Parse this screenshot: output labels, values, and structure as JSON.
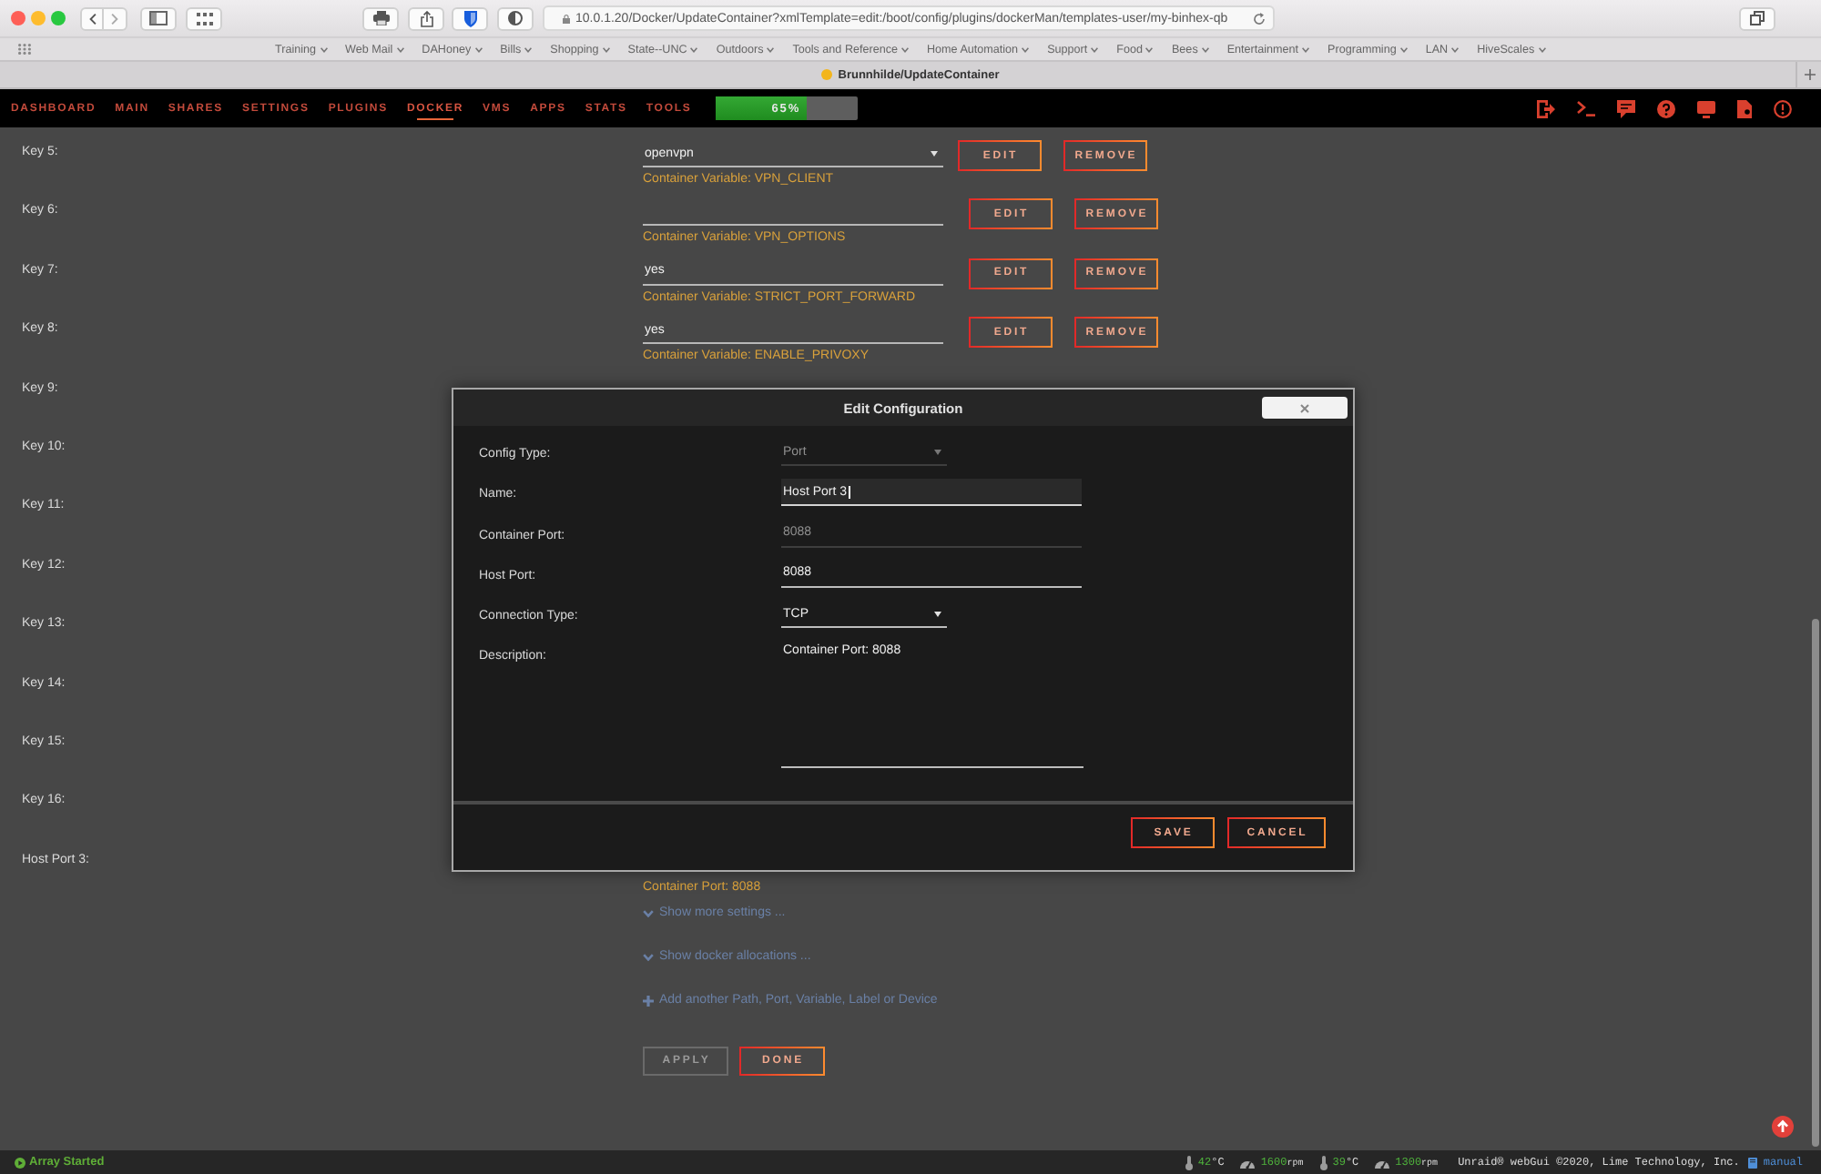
{
  "browser": {
    "url": "10.0.1.20/Docker/UpdateContainer?xmlTemplate=edit:/boot/config/plugins/dockerMan/templates-user/my-binhex-qb",
    "bookmarks": [
      "Training",
      "Web Mail",
      "DAHoney",
      "Bills",
      "Shopping",
      "State--UNC",
      "Outdoors",
      "Tools and Reference",
      "Home Automation",
      "Support",
      "Food",
      "Bees",
      "Entertainment",
      "Programming",
      "LAN",
      "HiveScales"
    ],
    "tab_title": "Brunnhilde/UpdateContainer"
  },
  "nav": {
    "items": [
      {
        "label": "DASHBOARD",
        "selected": false
      },
      {
        "label": "MAIN",
        "selected": false
      },
      {
        "label": "SHARES",
        "selected": false
      },
      {
        "label": "SETTINGS",
        "selected": false
      },
      {
        "label": "PLUGINS",
        "selected": false
      },
      {
        "label": "DOCKER",
        "selected": true
      },
      {
        "label": "VMS",
        "selected": false
      },
      {
        "label": "APPS",
        "selected": false
      },
      {
        "label": "STATS",
        "selected": false
      },
      {
        "label": "TOOLS",
        "selected": false
      }
    ],
    "progress": {
      "label": "65%",
      "level": 0.65
    }
  },
  "template_rows": [
    {
      "label": "Key 5:",
      "kind": "select",
      "value": "openvpn",
      "description": "Container Variable: VPN_CLIENT",
      "buttons": [
        "EDIT",
        "REMOVE"
      ]
    },
    {
      "label": "Key 6:",
      "kind": "text",
      "description": "Container Variable: VPN_OPTIONS",
      "buttons": [
        "EDIT",
        "REMOVE"
      ]
    },
    {
      "label": "Key 7:",
      "kind": "text",
      "value": "yes",
      "description": "Container Variable: STRICT_PORT_FORWARD",
      "buttons": [
        "EDIT",
        "REMOVE"
      ]
    },
    {
      "label": "Key 8:",
      "kind": "text",
      "value": "yes",
      "description": "Container Variable: ENABLE_PRIVOXY",
      "buttons": [
        "EDIT",
        "REMOVE"
      ]
    },
    {
      "label": "Key 9:",
      "kind": "covered"
    },
    {
      "label": "Key 10:",
      "kind": "covered"
    },
    {
      "label": "Key 11:",
      "kind": "covered"
    },
    {
      "label": "Key 12:",
      "kind": "covered"
    },
    {
      "label": "Key 13:",
      "kind": "covered"
    },
    {
      "label": "Key 14:",
      "kind": "covered"
    },
    {
      "label": "Key 15:",
      "kind": "covered"
    },
    {
      "label": "Key 16:",
      "kind": "covered"
    },
    {
      "label": "Host Port 3:",
      "kind": "covered",
      "description": "Container Port: 8088"
    }
  ],
  "links": [
    {
      "kind": "expand",
      "label": "Show more settings ..."
    },
    {
      "kind": "expand",
      "label": "Show docker allocations ..."
    },
    {
      "kind": "add",
      "label": "Add another Path, Port, Variable, Label or Device"
    }
  ],
  "actions": [
    {
      "label": "APPLY",
      "disabled": true
    },
    {
      "label": "DONE",
      "disabled": false
    }
  ],
  "dialog": {
    "title": "Edit Configuration",
    "fields": [
      {
        "label": "Config Type:",
        "kind": "select",
        "value": "Port",
        "disabled": true,
        "focused": false
      },
      {
        "label": "Name:",
        "kind": "input",
        "value": "Host Port 3",
        "disabled": false,
        "focused": true
      },
      {
        "label": "Container Port:",
        "kind": "input",
        "value": "8088",
        "disabled": true,
        "focused": false
      },
      {
        "label": "Host Port:",
        "kind": "input",
        "value": "8088",
        "disabled": false,
        "focused": false
      },
      {
        "label": "Connection Type:",
        "kind": "select",
        "value": "TCP",
        "disabled": false,
        "focused": false
      },
      {
        "label": "Description:",
        "kind": "textarea",
        "value": "Container Port: 8088",
        "disabled": false,
        "focused": false
      }
    ],
    "buttons": [
      "SAVE",
      "CANCEL"
    ]
  },
  "status_bar": {
    "array_status": "Array Started",
    "sensors": [
      {
        "kind": "temperature",
        "value": "42",
        "unit": "°C"
      },
      {
        "kind": "fan",
        "value": "1600",
        "unit": "rpm"
      },
      {
        "kind": "temperature",
        "value": "39",
        "unit": "°C"
      },
      {
        "kind": "fan",
        "value": "1300",
        "unit": "rpm"
      }
    ],
    "copyright": "Unraid® webGui ©2020, Lime Technology, Inc.",
    "manual": "manual"
  }
}
